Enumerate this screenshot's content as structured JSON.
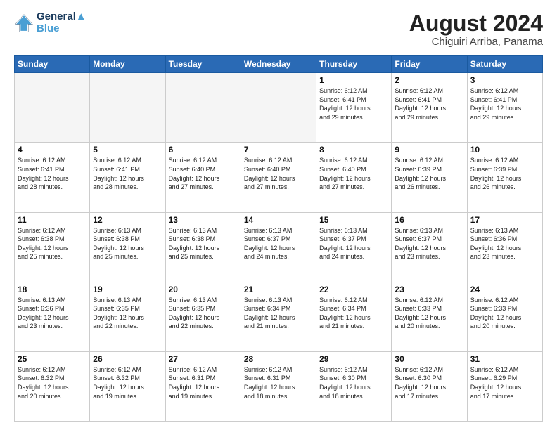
{
  "header": {
    "logo_line1": "General",
    "logo_line2": "Blue",
    "month": "August 2024",
    "location": "Chiguiri Arriba, Panama"
  },
  "days_of_week": [
    "Sunday",
    "Monday",
    "Tuesday",
    "Wednesday",
    "Thursday",
    "Friday",
    "Saturday"
  ],
  "weeks": [
    [
      {
        "day": "",
        "info": "",
        "empty": true
      },
      {
        "day": "",
        "info": "",
        "empty": true
      },
      {
        "day": "",
        "info": "",
        "empty": true
      },
      {
        "day": "",
        "info": "",
        "empty": true
      },
      {
        "day": "1",
        "info": "Sunrise: 6:12 AM\nSunset: 6:41 PM\nDaylight: 12 hours\nand 29 minutes.",
        "empty": false
      },
      {
        "day": "2",
        "info": "Sunrise: 6:12 AM\nSunset: 6:41 PM\nDaylight: 12 hours\nand 29 minutes.",
        "empty": false
      },
      {
        "day": "3",
        "info": "Sunrise: 6:12 AM\nSunset: 6:41 PM\nDaylight: 12 hours\nand 29 minutes.",
        "empty": false
      }
    ],
    [
      {
        "day": "4",
        "info": "Sunrise: 6:12 AM\nSunset: 6:41 PM\nDaylight: 12 hours\nand 28 minutes.",
        "empty": false
      },
      {
        "day": "5",
        "info": "Sunrise: 6:12 AM\nSunset: 6:41 PM\nDaylight: 12 hours\nand 28 minutes.",
        "empty": false
      },
      {
        "day": "6",
        "info": "Sunrise: 6:12 AM\nSunset: 6:40 PM\nDaylight: 12 hours\nand 27 minutes.",
        "empty": false
      },
      {
        "day": "7",
        "info": "Sunrise: 6:12 AM\nSunset: 6:40 PM\nDaylight: 12 hours\nand 27 minutes.",
        "empty": false
      },
      {
        "day": "8",
        "info": "Sunrise: 6:12 AM\nSunset: 6:40 PM\nDaylight: 12 hours\nand 27 minutes.",
        "empty": false
      },
      {
        "day": "9",
        "info": "Sunrise: 6:12 AM\nSunset: 6:39 PM\nDaylight: 12 hours\nand 26 minutes.",
        "empty": false
      },
      {
        "day": "10",
        "info": "Sunrise: 6:12 AM\nSunset: 6:39 PM\nDaylight: 12 hours\nand 26 minutes.",
        "empty": false
      }
    ],
    [
      {
        "day": "11",
        "info": "Sunrise: 6:12 AM\nSunset: 6:38 PM\nDaylight: 12 hours\nand 25 minutes.",
        "empty": false
      },
      {
        "day": "12",
        "info": "Sunrise: 6:13 AM\nSunset: 6:38 PM\nDaylight: 12 hours\nand 25 minutes.",
        "empty": false
      },
      {
        "day": "13",
        "info": "Sunrise: 6:13 AM\nSunset: 6:38 PM\nDaylight: 12 hours\nand 25 minutes.",
        "empty": false
      },
      {
        "day": "14",
        "info": "Sunrise: 6:13 AM\nSunset: 6:37 PM\nDaylight: 12 hours\nand 24 minutes.",
        "empty": false
      },
      {
        "day": "15",
        "info": "Sunrise: 6:13 AM\nSunset: 6:37 PM\nDaylight: 12 hours\nand 24 minutes.",
        "empty": false
      },
      {
        "day": "16",
        "info": "Sunrise: 6:13 AM\nSunset: 6:37 PM\nDaylight: 12 hours\nand 23 minutes.",
        "empty": false
      },
      {
        "day": "17",
        "info": "Sunrise: 6:13 AM\nSunset: 6:36 PM\nDaylight: 12 hours\nand 23 minutes.",
        "empty": false
      }
    ],
    [
      {
        "day": "18",
        "info": "Sunrise: 6:13 AM\nSunset: 6:36 PM\nDaylight: 12 hours\nand 23 minutes.",
        "empty": false
      },
      {
        "day": "19",
        "info": "Sunrise: 6:13 AM\nSunset: 6:35 PM\nDaylight: 12 hours\nand 22 minutes.",
        "empty": false
      },
      {
        "day": "20",
        "info": "Sunrise: 6:13 AM\nSunset: 6:35 PM\nDaylight: 12 hours\nand 22 minutes.",
        "empty": false
      },
      {
        "day": "21",
        "info": "Sunrise: 6:13 AM\nSunset: 6:34 PM\nDaylight: 12 hours\nand 21 minutes.",
        "empty": false
      },
      {
        "day": "22",
        "info": "Sunrise: 6:12 AM\nSunset: 6:34 PM\nDaylight: 12 hours\nand 21 minutes.",
        "empty": false
      },
      {
        "day": "23",
        "info": "Sunrise: 6:12 AM\nSunset: 6:33 PM\nDaylight: 12 hours\nand 20 minutes.",
        "empty": false
      },
      {
        "day": "24",
        "info": "Sunrise: 6:12 AM\nSunset: 6:33 PM\nDaylight: 12 hours\nand 20 minutes.",
        "empty": false
      }
    ],
    [
      {
        "day": "25",
        "info": "Sunrise: 6:12 AM\nSunset: 6:32 PM\nDaylight: 12 hours\nand 20 minutes.",
        "empty": false
      },
      {
        "day": "26",
        "info": "Sunrise: 6:12 AM\nSunset: 6:32 PM\nDaylight: 12 hours\nand 19 minutes.",
        "empty": false
      },
      {
        "day": "27",
        "info": "Sunrise: 6:12 AM\nSunset: 6:31 PM\nDaylight: 12 hours\nand 19 minutes.",
        "empty": false
      },
      {
        "day": "28",
        "info": "Sunrise: 6:12 AM\nSunset: 6:31 PM\nDaylight: 12 hours\nand 18 minutes.",
        "empty": false
      },
      {
        "day": "29",
        "info": "Sunrise: 6:12 AM\nSunset: 6:30 PM\nDaylight: 12 hours\nand 18 minutes.",
        "empty": false
      },
      {
        "day": "30",
        "info": "Sunrise: 6:12 AM\nSunset: 6:30 PM\nDaylight: 12 hours\nand 17 minutes.",
        "empty": false
      },
      {
        "day": "31",
        "info": "Sunrise: 6:12 AM\nSunset: 6:29 PM\nDaylight: 12 hours\nand 17 minutes.",
        "empty": false
      }
    ]
  ]
}
